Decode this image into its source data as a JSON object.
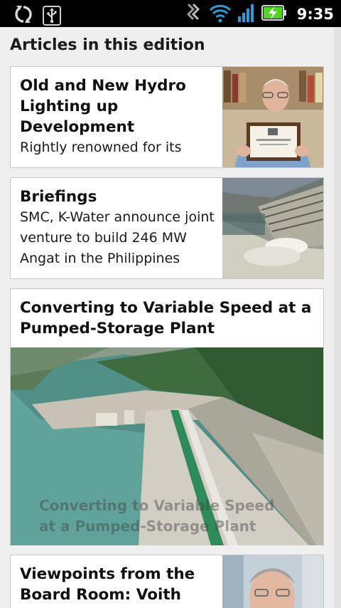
{
  "status_bar": {
    "time": "9:35",
    "left_icons": [
      "sync-icon",
      "usb-icon"
    ],
    "right_icons": [
      "data-activity-icon",
      "wifi-icon",
      "cell-signal-icon",
      "battery-charging-icon"
    ]
  },
  "section": {
    "title": "Articles in this edition"
  },
  "articles": [
    {
      "headline": "Old and New Hydro Lighting up Development",
      "summary": "Rightly renowned for its",
      "image": "man-holding-certificate-photo"
    },
    {
      "headline": "Briefings",
      "summary": "SMC, K-Water announce joint venture to build 246 MW Angat in the Philippines",
      "image": "dam-spillway-photo"
    },
    {
      "headline": "Converting to Variable Speed at a Pumped-Storage Plant",
      "summary": "",
      "image": "pumped-storage-dam-aerial-photo"
    },
    {
      "headline": "Viewpoints from the Board Room: Voith",
      "summary": "",
      "image": "board-member-portrait-photo"
    }
  ],
  "colors": {
    "background": "#efefef",
    "card": "#ffffff",
    "status_bar": "#000000",
    "battery_green": "#4fd61d",
    "signal_blue": "#2a9ad8"
  }
}
